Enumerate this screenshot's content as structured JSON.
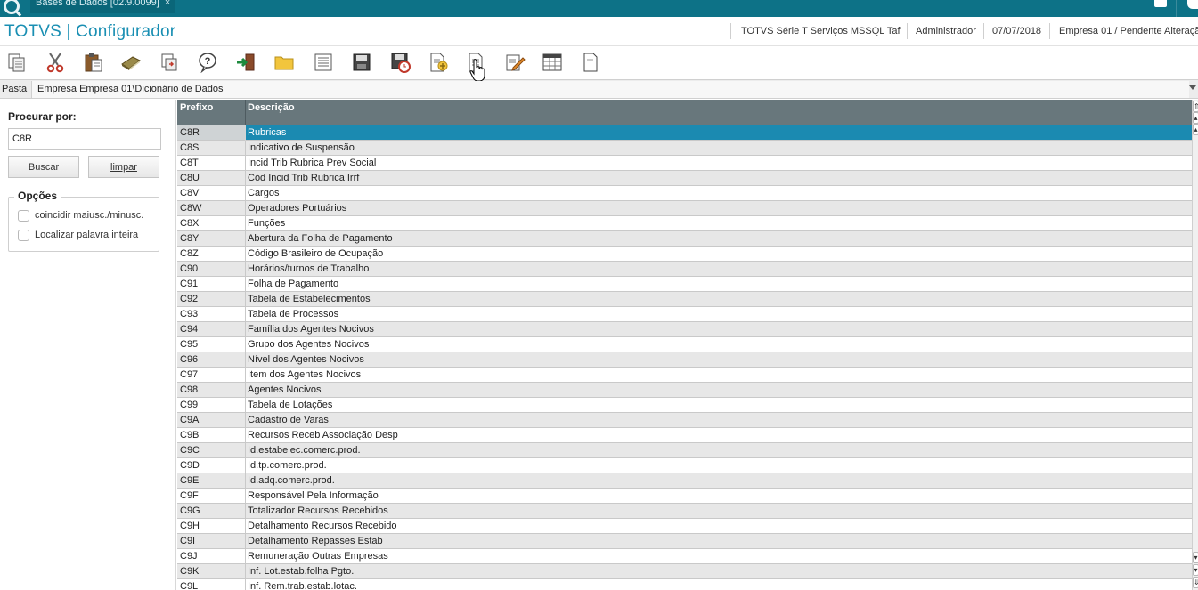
{
  "topbar": {
    "tab_label": "Bases de Dados [02.9.0099]",
    "tab_close": "×"
  },
  "header": {
    "title": "TOTVS | Configurador",
    "environment": "TOTVS Série T Serviços MSSQL Taf",
    "user": "Administrador",
    "date": "07/07/2018",
    "company": "Empresa 01 / Pendente Alteraçã"
  },
  "toolbar": {
    "buttons": [
      "copy-icon",
      "cut-icon",
      "paste-icon",
      "book-icon",
      "print-icon",
      "help-icon",
      "exit-icon",
      "folder-icon",
      "list-icon",
      "save-icon",
      "save-clock-icon",
      "new-document-icon",
      "document-icon",
      "edit-icon",
      "table-icon",
      "blank-page-icon"
    ]
  },
  "pasta": {
    "label": "Pasta",
    "path": "Empresa Empresa 01\\Dicionário de Dados"
  },
  "search": {
    "label": "Procurar por:",
    "value": "C8R",
    "search_button": "Buscar",
    "clear_button": "limpar"
  },
  "options": {
    "legend": "Opções",
    "match_case": "coincidir maiusc./minusc.",
    "whole_word": "Localizar palavra inteira"
  },
  "grid": {
    "columns": [
      "Prefixo",
      "Descrição"
    ],
    "rows": [
      {
        "prefix": "C8R",
        "desc": "Rubricas"
      },
      {
        "prefix": "C8S",
        "desc": "Indicativo de Suspensão"
      },
      {
        "prefix": "C8T",
        "desc": "Incid Trib Rubrica Prev Social"
      },
      {
        "prefix": "C8U",
        "desc": "Cód Incid Trib Rubrica Irrf"
      },
      {
        "prefix": "C8V",
        "desc": "Cargos"
      },
      {
        "prefix": "C8W",
        "desc": "Operadores Portuários"
      },
      {
        "prefix": "C8X",
        "desc": "Funções"
      },
      {
        "prefix": "C8Y",
        "desc": "Abertura da Folha de Pagamento"
      },
      {
        "prefix": "C8Z",
        "desc": "Código Brasileiro de Ocupação"
      },
      {
        "prefix": "C90",
        "desc": "Horários/turnos de Trabalho"
      },
      {
        "prefix": "C91",
        "desc": "Folha de Pagamento"
      },
      {
        "prefix": "C92",
        "desc": "Tabela de Estabelecimentos"
      },
      {
        "prefix": "C93",
        "desc": "Tabela de Processos"
      },
      {
        "prefix": "C94",
        "desc": "Família dos Agentes Nocivos"
      },
      {
        "prefix": "C95",
        "desc": "Grupo dos Agentes Nocivos"
      },
      {
        "prefix": "C96",
        "desc": "Nível dos Agentes Nocivos"
      },
      {
        "prefix": "C97",
        "desc": "Item dos Agentes Nocivos"
      },
      {
        "prefix": "C98",
        "desc": "Agentes Nocivos"
      },
      {
        "prefix": "C99",
        "desc": "Tabela de Lotações"
      },
      {
        "prefix": "C9A",
        "desc": "Cadastro de Varas"
      },
      {
        "prefix": "C9B",
        "desc": "Recursos Receb Associação Desp"
      },
      {
        "prefix": "C9C",
        "desc": "Id.estabelec.comerc.prod."
      },
      {
        "prefix": "C9D",
        "desc": "Id.tp.comerc.prod."
      },
      {
        "prefix": "C9E",
        "desc": "Id.adq.comerc.prod."
      },
      {
        "prefix": "C9F",
        "desc": "Responsável Pela Informação"
      },
      {
        "prefix": "C9G",
        "desc": "Totalizador Recursos Recebidos"
      },
      {
        "prefix": "C9H",
        "desc": "Detalhamento Recursos Recebido"
      },
      {
        "prefix": "C9I",
        "desc": "Detalhamento Repasses Estab"
      },
      {
        "prefix": "C9J",
        "desc": "Remuneração Outras Empresas"
      },
      {
        "prefix": "C9K",
        "desc": "Inf. Lot.estab.folha Pgto."
      },
      {
        "prefix": "C9L",
        "desc": "Inf. Rem.trab.estab.lotac."
      }
    ]
  }
}
